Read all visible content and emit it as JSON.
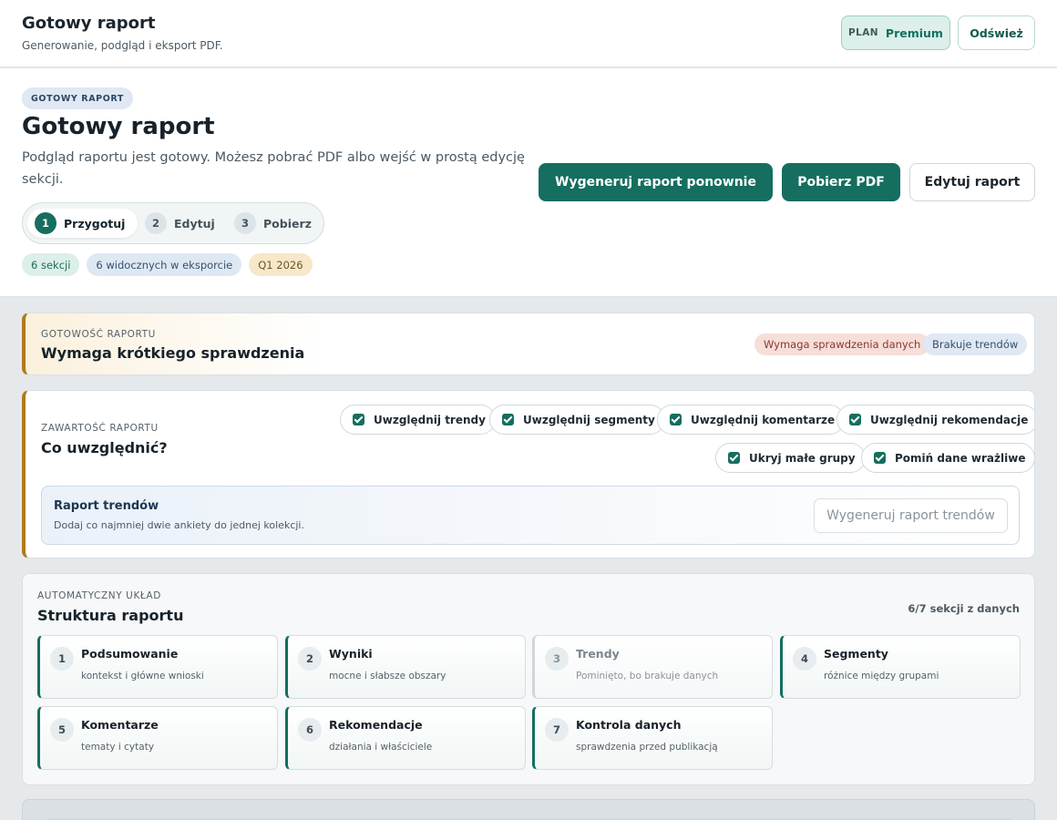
{
  "topbar": {
    "title": "Gotowy raport",
    "subtitle": "Generowanie, podgląd i eksport PDF.",
    "plan_key": "PLAN",
    "plan_value": "Premium",
    "refresh_label": "Odśwież"
  },
  "hero": {
    "tag": "GOTOWY RAPORT",
    "title": "Gotowy raport",
    "description": "Podgląd raportu jest gotowy. Możesz pobrać PDF albo wejść w prostą edycję sekcji.",
    "steps": [
      {
        "number": "1",
        "label": "Przygotuj"
      },
      {
        "number": "2",
        "label": "Edytuj"
      },
      {
        "number": "3",
        "label": "Pobierz"
      }
    ],
    "chips": [
      "6 sekcji",
      "6 widocznych w eksporcie",
      "Q1 2026"
    ],
    "buttons": {
      "regenerate": "Wygeneruj raport ponownie",
      "download_pdf": "Pobierz PDF",
      "edit": "Edytuj raport"
    }
  },
  "readiness": {
    "eyebrow": "GOTOWOŚĆ RAPORTU",
    "title": "Wymaga krótkiego sprawdzenia",
    "tags": [
      "Wymaga sprawdzenia danych",
      "Brakuje trendów"
    ]
  },
  "content": {
    "eyebrow": "ZAWARTOŚĆ RAPORTU",
    "title": "Co uwzględnić?",
    "options": [
      {
        "label": "Uwzględnij trendy",
        "checked": true
      },
      {
        "label": "Uwzględnij segmenty",
        "checked": true
      },
      {
        "label": "Uwzględnij komentarze",
        "checked": true
      },
      {
        "label": "Uwzględnij rekomendacje",
        "checked": true
      },
      {
        "label": "Ukryj małe grupy",
        "checked": true
      },
      {
        "label": "Pomiń dane wrażliwe",
        "checked": true
      }
    ],
    "trend_report": {
      "title": "Raport trendów",
      "description": "Dodaj co najmniej dwie ankiety do jednej kolekcji.",
      "button": "Wygeneruj raport trendów"
    }
  },
  "structure": {
    "eyebrow": "AUTOMATYCZNY UKŁAD",
    "title": "Struktura raportu",
    "count": "6/7 sekcji z danych",
    "sections": [
      {
        "number": "1",
        "name": "Podsumowanie",
        "desc": "kontekst i główne wnioski",
        "active": true
      },
      {
        "number": "2",
        "name": "Wyniki",
        "desc": "mocne i słabsze obszary",
        "active": true
      },
      {
        "number": "3",
        "name": "Trendy",
        "desc": "Pominięto, bo brakuje danych",
        "active": false
      },
      {
        "number": "4",
        "name": "Segmenty",
        "desc": "różnice między grupami",
        "active": true
      },
      {
        "number": "5",
        "name": "Komentarze",
        "desc": "tematy i cytaty",
        "active": true
      },
      {
        "number": "6",
        "name": "Rekomendacje",
        "desc": "działania i właściciele",
        "active": true
      },
      {
        "number": "7",
        "name": "Kontrola danych",
        "desc": "sprawdzenia przed publikacją",
        "active": true
      }
    ]
  },
  "colors": {
    "accent": "#156e5f",
    "warning_border": "#b07a1c"
  }
}
